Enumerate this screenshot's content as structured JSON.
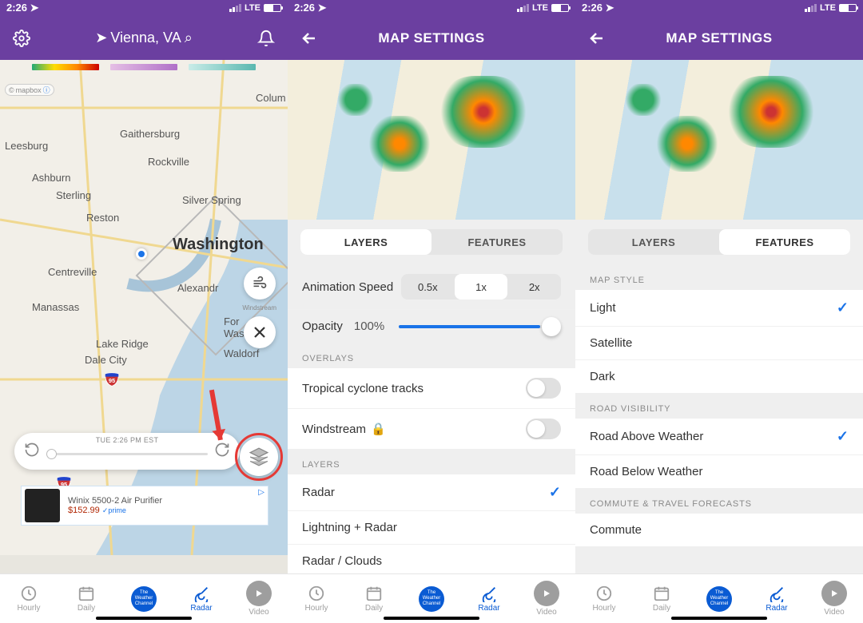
{
  "status": {
    "time": "2:26",
    "network": "LTE"
  },
  "pane1": {
    "location": "Vienna, VA",
    "timeline_label": "TUE 2:26 PM EST",
    "windstream_label": "Windstream",
    "mapbox": "mapbox",
    "cities": {
      "columbia": "Colum",
      "gaithersburg": "Gaithersburg",
      "rockville": "Rockville",
      "leesburg": "Leesburg",
      "ashburn": "Ashburn",
      "sterling": "Sterling",
      "reston": "Reston",
      "silver_spring": "Silver Spring",
      "washington": "Washington",
      "centreville": "Centreville",
      "alexandria": "Alexandr",
      "manassas": "Manassas",
      "fort_washington": "For\nWashin",
      "lake_ridge": "Lake Ridge",
      "dale_city": "Dale City",
      "waldorf": "Waldorf"
    },
    "ad": {
      "title": "Winix 5500-2 Air Purifier",
      "price": "$152.99",
      "prime": "✓prime"
    }
  },
  "settings": {
    "title": "MAP SETTINGS",
    "tabs": {
      "layers": "LAYERS",
      "features": "FEATURES"
    },
    "animation_speed_label": "Animation Speed",
    "speeds": [
      "0.5x",
      "1x",
      "2x"
    ],
    "speed_selected": "1x",
    "opacity_label": "Opacity",
    "opacity_value": "100%",
    "overlays_header": "OVERLAYS",
    "overlays": {
      "tropical": "Tropical cyclone tracks",
      "windstream": "Windstream"
    },
    "layers_header": "LAYERS",
    "layer_items": {
      "radar": "Radar",
      "lightning": "Lightning + Radar",
      "clouds": "Radar / Clouds"
    },
    "map_style_header": "MAP STYLE",
    "styles": {
      "light": "Light",
      "satellite": "Satellite",
      "dark": "Dark"
    },
    "road_header": "ROAD VISIBILITY",
    "roads": {
      "above": "Road Above Weather",
      "below": "Road Below Weather"
    },
    "commute_header": "COMMUTE & TRAVEL FORECASTS",
    "commute": "Commute"
  },
  "nav": {
    "hourly": "Hourly",
    "daily": "Daily",
    "twc": "The Weather Channel",
    "radar": "Radar",
    "video": "Video"
  }
}
